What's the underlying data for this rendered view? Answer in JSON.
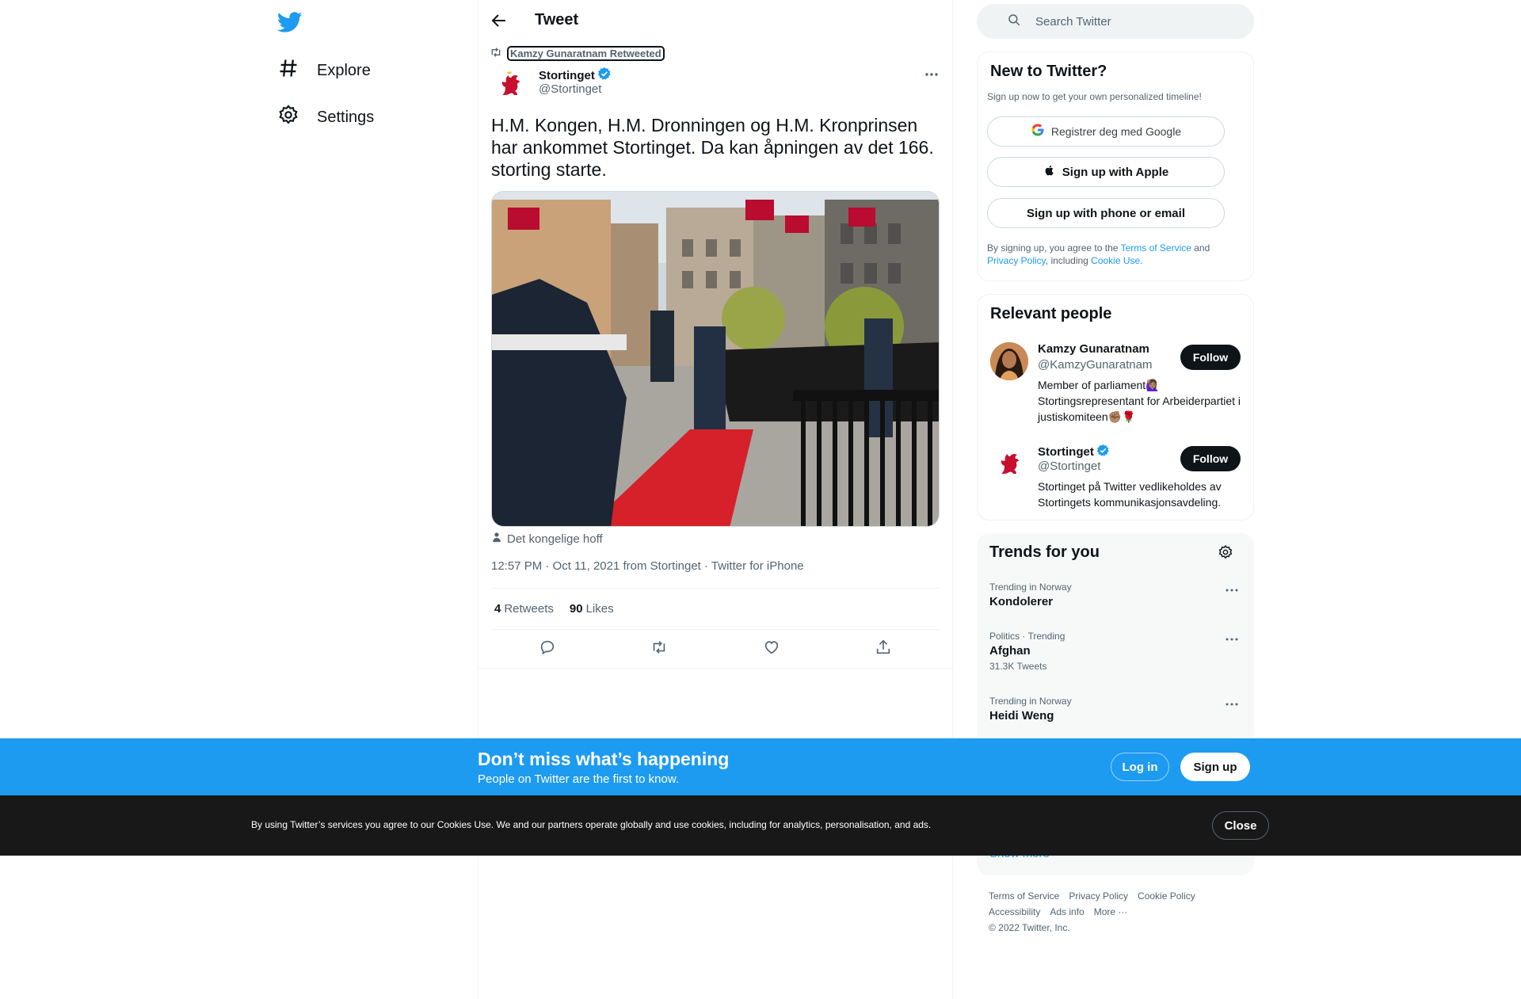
{
  "nav": {
    "items": [
      {
        "label": "Explore",
        "icon": "hashtag-icon"
      },
      {
        "label": "Settings",
        "icon": "gear-icon"
      }
    ]
  },
  "header": {
    "title": "Tweet"
  },
  "tweet": {
    "retweeted_by": "Kamzy Gunaratnam Retweeted",
    "author_name": "Stortinget",
    "author_handle": "@Stortinget",
    "text": "H.M. Kongen, H.M. Dronningen og H.M. Kronprinsen har ankommet Stortinget. Da kan åpningen av det 166. storting starte.",
    "tagged": "Det kongelige hoff",
    "time": "12:57 PM · Oct 11, 2021 from Stortinget · Twitter for iPhone",
    "retweets_count": "4",
    "retweets_label": "Retweets",
    "likes_count": "90",
    "likes_label": "Likes"
  },
  "search": {
    "placeholder": "Search Twitter"
  },
  "signup": {
    "title": "New to Twitter?",
    "subtitle": "Sign up now to get your own personalized timeline!",
    "google_label": "Registrer deg med Google",
    "apple_label": "Sign up with Apple",
    "phone_label": "Sign up with phone or email",
    "terms_prefix": "By signing up, you agree to the ",
    "terms_link": "Terms of Service",
    "terms_and": " and",
    "privacy_link": "Privacy Policy",
    "including": ", including ",
    "cookie_link": "Cookie Use."
  },
  "relevant": {
    "title": "Relevant people",
    "people": [
      {
        "name": "Kamzy Gunaratnam",
        "handle": "@KamzyGunaratnam",
        "bio": "Member of parliament🙋🏽‍♀️ Stortingsrepresentant for Arbeiderpartiet i justiskomiteen✊🏽🌹",
        "follow": "Follow"
      },
      {
        "name": "Stortinget",
        "handle": "@Stortinget",
        "bio": "Stortinget på Twitter vedlikeholdes av Stortingets kommunikasjonsavdeling.",
        "follow": "Follow"
      }
    ]
  },
  "trends": {
    "title": "Trends for you",
    "items": [
      {
        "meta": "Trending in Norway",
        "name": "Kondolerer",
        "count": ""
      },
      {
        "meta": "Politics · Trending",
        "name": "Afghan",
        "count": "31.3K Tweets"
      },
      {
        "meta": "Trending in Norway",
        "name": "Heidi Weng",
        "count": ""
      }
    ],
    "show_more": "Show more"
  },
  "footer": {
    "terms": "Terms of Service",
    "privacy": "Privacy Policy",
    "cookie": "Cookie Policy",
    "accessibility": "Accessibility",
    "ads": "Ads info",
    "more": "More ···",
    "copyright": "© 2022 Twitter, Inc."
  },
  "banner": {
    "title": "Don’t miss what’s happening",
    "subtitle": "People on Twitter are the first to know.",
    "login": "Log in",
    "signup": "Sign up"
  },
  "cookie_bar": {
    "text": "By using Twitter’s services you agree to our Cookies Use. We and our partners operate globally and use cookies, including for analytics, personalisation, and ads.",
    "close": "Close"
  },
  "colors": {
    "accent": "#1d9bf0",
    "dark": "#0f1419",
    "muted": "#536471",
    "verified": "#1d9bf0"
  }
}
